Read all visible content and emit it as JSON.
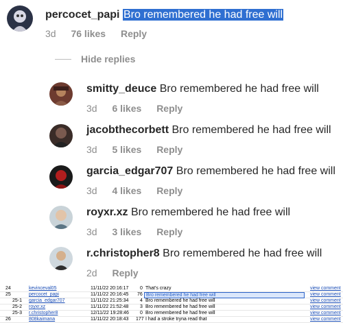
{
  "top_comment": {
    "username": "percocet_papi",
    "text": "Bro remembered he had free will",
    "time": "3d",
    "likes": "76 likes",
    "reply": "Reply"
  },
  "hide_replies": "Hide replies",
  "replies": [
    {
      "username": "smitty_deuce",
      "text": "Bro remembered he had free will",
      "time": "3d",
      "likes": "6 likes",
      "reply": "Reply"
    },
    {
      "username": "jacobthecorbett",
      "text": "Bro remembered he had free will",
      "time": "3d",
      "likes": "5 likes",
      "reply": "Reply"
    },
    {
      "username": "garcia_edgar707",
      "text": "Bro remembered he had free will",
      "time": "3d",
      "likes": "4 likes",
      "reply": "Reply"
    },
    {
      "username": "royxr.xz",
      "text": "Bro remembered he had free will",
      "time": "3d",
      "likes": "3 likes",
      "reply": "Reply"
    },
    {
      "username": "r.christopher8",
      "text": "Bro remembered he had free will",
      "time": "2d",
      "likes": "",
      "reply": "Reply"
    }
  ],
  "sheet": {
    "rows": [
      {
        "id": "24",
        "user": "kevinceval05",
        "date": "11/11/22 20:16:17",
        "likes": "0",
        "text": "That's crazy",
        "link": "view comment"
      },
      {
        "id": "25",
        "user": "percocet_papi",
        "date": "11/11/22 20:16:45",
        "likes": "76",
        "text": "Bro remembered he had free will",
        "link": "view comment"
      },
      {
        "id": "25-1",
        "user": "garcia_edgar707",
        "date": "11/11/22 21:25:34",
        "likes": "4",
        "text": "Bro remembered he had free will",
        "link": "view comment"
      },
      {
        "id": "25-2",
        "user": "royxr.xz",
        "date": "11/11/22 21:52:48",
        "likes": "3",
        "text": "Bro remembered he had free will",
        "link": "view comment"
      },
      {
        "id": "25-3",
        "user": "r.christopher8",
        "date": "12/11/22 19:28:46",
        "likes": "0",
        "text": "Bro remembered he had free will",
        "link": "view comment"
      },
      {
        "id": "26",
        "user": "808kaimana",
        "date": "11/11/22 20:18:43",
        "likes": "177",
        "text": "I had a stroke tryna read that",
        "link": "view comment"
      }
    ]
  }
}
